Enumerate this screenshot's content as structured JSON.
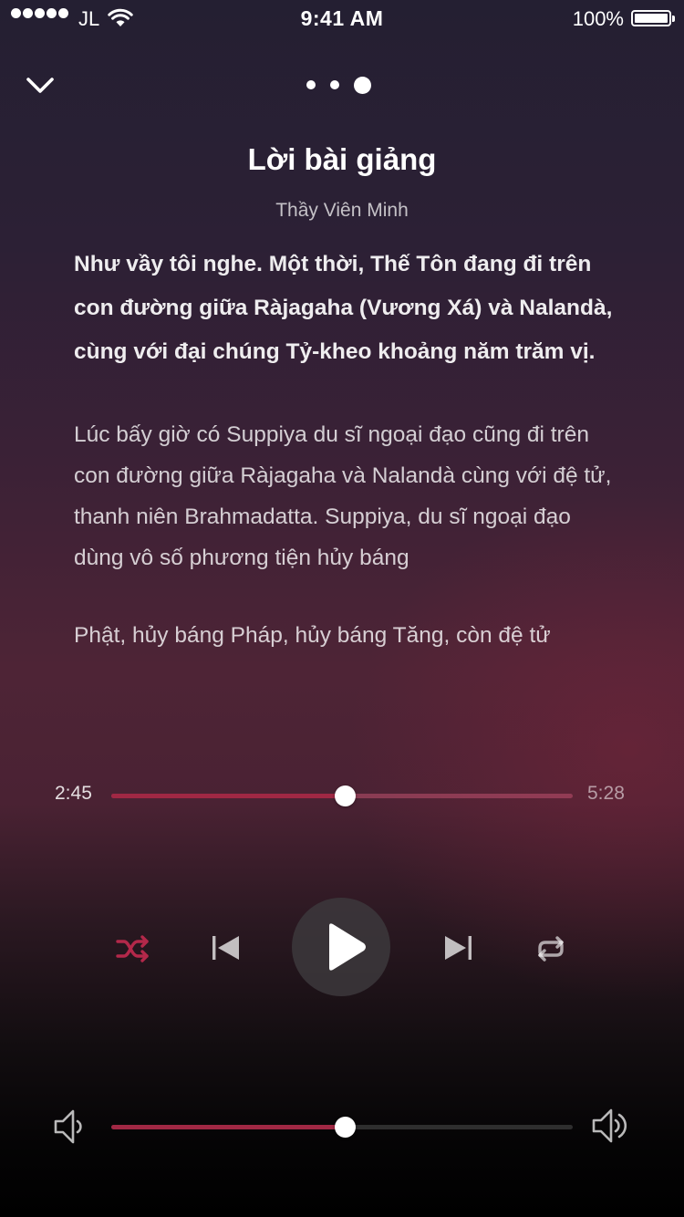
{
  "status_bar": {
    "carrier": "JL",
    "time": "9:41 AM",
    "battery_percent": "100%",
    "signal_bars": 5,
    "icons": [
      "signal-dots-icon",
      "wifi-icon",
      "battery-icon"
    ]
  },
  "nav": {
    "collapse_icon": "chevron-down-icon",
    "page_count": 3,
    "active_page": 3
  },
  "header": {
    "title": "Lời bài giảng",
    "subtitle": "Thầy Viên Minh"
  },
  "lyrics": {
    "paragraph_1": "Như vầy tôi nghe. Một thời, Thế Tôn đang đi trên con đường giữa Ràjagaha (Vương Xá) và Nalandà, cùng với đại chúng Tỷ-kheo khoảng năm trăm vị.",
    "paragraph_2": "Lúc bấy giờ có Suppiya du sĩ ngoại đạo cũng đi trên con đường giữa Ràjagaha và Nalandà cùng với đệ tử, thanh niên Brahmadatta. Suppiya, du sĩ ngoại đạo dùng vô số phương tiện hủy báng",
    "paragraph_3": "Phật, hủy báng Pháp, hủy báng Tăng, còn đệ tử"
  },
  "progress": {
    "elapsed": "2:45",
    "total": "5:28",
    "fraction": 0.505
  },
  "controls": {
    "shuffle_icon": "shuffle-icon",
    "previous_icon": "skip-previous-icon",
    "play_icon": "play-icon",
    "next_icon": "skip-next-icon",
    "repeat_icon": "repeat-icon",
    "shuffle_active": true
  },
  "volume": {
    "level": 0.505,
    "low_icon": "volume-low-icon",
    "high_icon": "volume-high-icon"
  },
  "colors": {
    "accent": "#a02844",
    "text": "#ffffff",
    "shuffle_active": "#b3284a"
  }
}
